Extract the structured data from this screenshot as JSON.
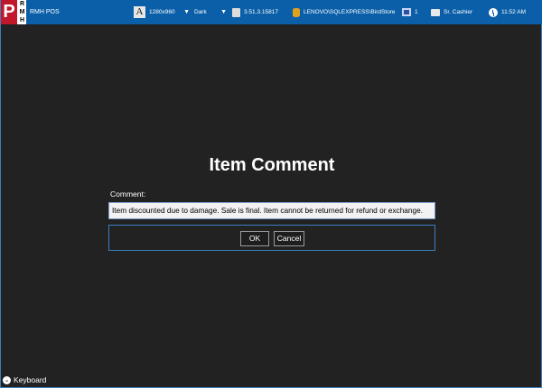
{
  "app": {
    "logo_letter": "P",
    "logo_stack": [
      "R",
      "M",
      "H"
    ],
    "title": "RMH POS"
  },
  "topbar": {
    "resolution": {
      "icon_glyph": "A",
      "value": "1280x960",
      "caret": "▼"
    },
    "theme": {
      "value": "Dark",
      "caret": "▼"
    },
    "version": "3.51.3.15817",
    "database": "LENOVO\\SQLEXPRESS\\BirdStore",
    "register_count": "1",
    "user_role": "Sr. Cashier",
    "time": "11:52 AM"
  },
  "dialog": {
    "title": "Item Comment",
    "comment_label": "Comment:",
    "comment_value": "Item discounted due to damage. Sale is final. Item cannot be returned for refund or exchange.",
    "ok_label": "OK",
    "cancel_label": "Cancel"
  },
  "footer": {
    "keyboard_label": "Keyboard",
    "keyboard_glyph": "⌄"
  },
  "colors": {
    "topbar": "#0a5fa8",
    "background": "#222222",
    "logo_red": "#c0182a",
    "accent_border": "#3a7fc0"
  }
}
